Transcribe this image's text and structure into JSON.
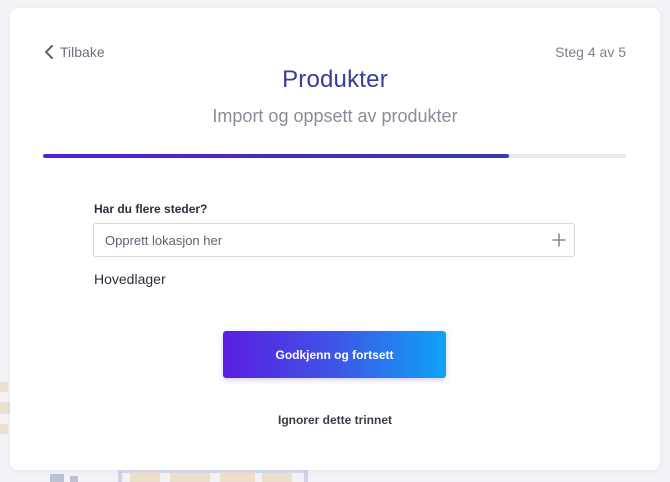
{
  "header": {
    "back_label": "Tilbake",
    "step_label": "Steg 4 av 5",
    "title": "Produkter",
    "subtitle": "Import og oppsett av produkter"
  },
  "progress": {
    "fraction": 0.8
  },
  "location_form": {
    "label": "Har du flere steder?",
    "input_placeholder": "Opprett lokasjon her",
    "input_value": "",
    "add_icon": "plus-icon",
    "locations": [
      "Hovedlager"
    ]
  },
  "actions": {
    "primary_label": "Godkjenn og fortsett",
    "skip_label": "Ignorer dette trinnet"
  },
  "colors": {
    "accent": "#3b3b9a",
    "progress_start": "#5b1fd9",
    "button_gradient_start": "#5a1ee0",
    "button_gradient_end": "#0ea3f7"
  }
}
